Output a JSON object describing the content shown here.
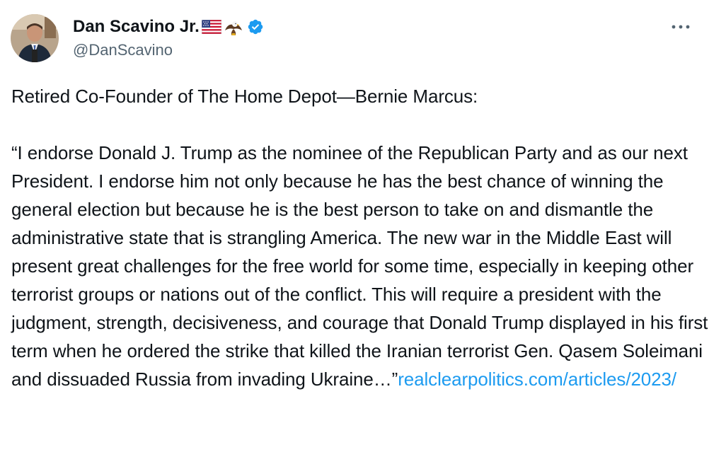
{
  "author": {
    "display_name": "Dan Scavino Jr.",
    "handle": "@DanScavino",
    "name_emojis": [
      "us-flag-icon",
      "eagle-icon"
    ],
    "verified": true
  },
  "tweet": {
    "headline": "Retired Co-Founder of The Home Depot—Bernie Marcus:",
    "quote": "“I endorse Donald J. Trump as the nominee of the Republican Party and as our next President. I endorse him not only because he has the best chance of winning the general election but because he is the best person to take on and dismantle the administrative state that is strangling America. The new war in the Middle East will present great challenges for the free world for some time, especially in keeping other terrorist groups or nations out of the conflict. This will require a president with the judgment, strength, decisiveness, and courage that Donald Trump displayed in his first term when he ordered the strike that killed the Iranian terrorist Gen. Qasem Soleimani and dissuaded Russia from invading Ukraine…”",
    "link_text": "realclearpolitics.com/articles/2023/"
  },
  "colors": {
    "text": "#0f1419",
    "secondary": "#536471",
    "link": "#1d9bf0",
    "verified": "#1d9bf0"
  },
  "icons": {
    "more": "more-horizontal-icon",
    "verified": "verified-badge-icon"
  }
}
